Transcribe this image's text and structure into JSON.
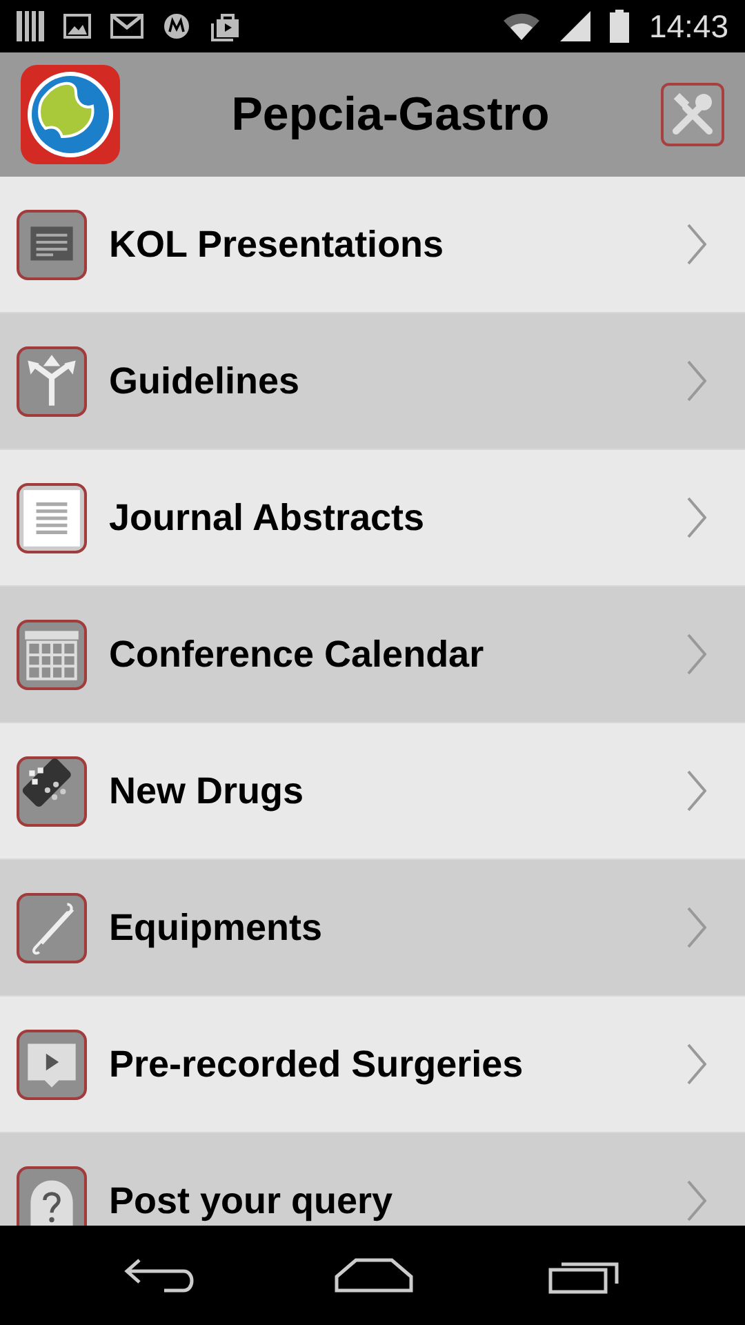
{
  "status_bar": {
    "time": "14:43"
  },
  "app_bar": {
    "title": "Pepcia-Gastro"
  },
  "menu": [
    {
      "label": "KOL Presentations",
      "kind": "slides"
    },
    {
      "label": "Guidelines",
      "kind": "directions"
    },
    {
      "label": "Journal Abstracts",
      "kind": "document"
    },
    {
      "label": "Conference Calendar",
      "kind": "calendar"
    },
    {
      "label": "New Drugs",
      "kind": "pills"
    },
    {
      "label": "Equipments",
      "kind": "hooks"
    },
    {
      "label": "Pre-recorded Surgeries",
      "kind": "video"
    },
    {
      "label": "Post your query",
      "kind": "question"
    }
  ]
}
